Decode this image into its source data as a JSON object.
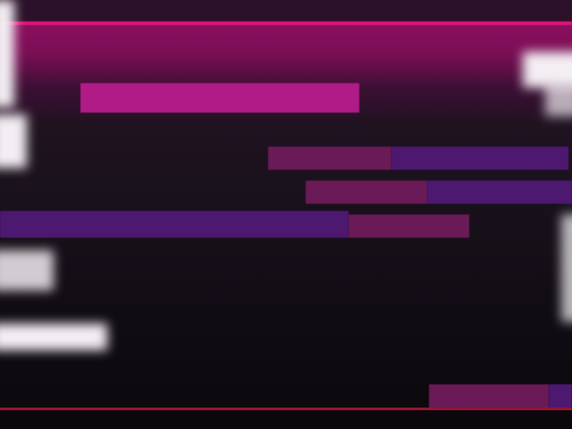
{
  "colors": {
    "background_top": "#2a1128",
    "accent_line": "#e2137a",
    "banner": "#8a0f5e",
    "highlight_bar": "#b01b87",
    "bar_pink": "#6a1a57",
    "bar_violet": "#4d1870",
    "bottom_line": "#9a1232",
    "background_bottom": "#0a080c"
  }
}
